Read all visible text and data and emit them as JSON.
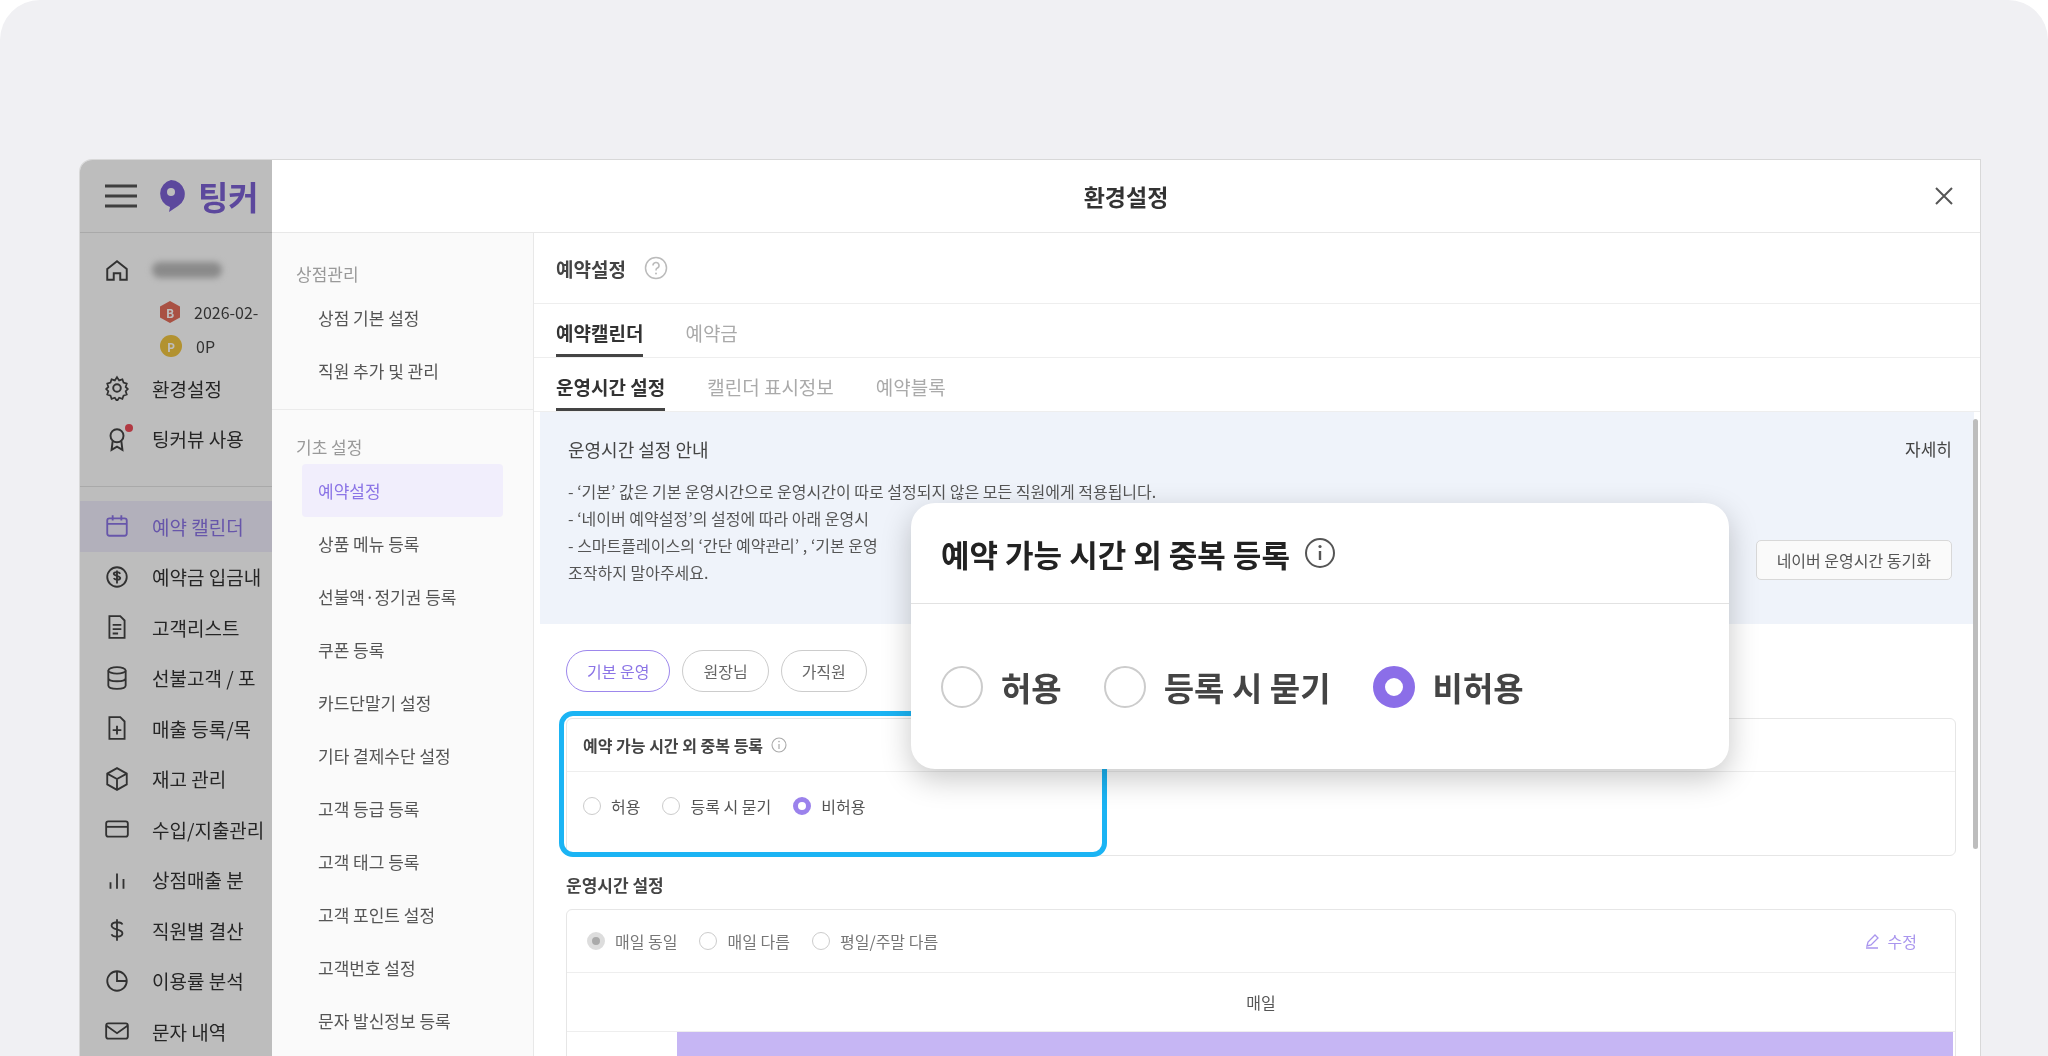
{
  "sidebar": {
    "logo": "팅커",
    "date": "2026-02-",
    "grade_badge": "B",
    "point_badge": "P",
    "points": "0P",
    "top_items": [
      {
        "label": "환경설정",
        "alert": false
      },
      {
        "label": "팅커뷰 사용",
        "alert": true
      }
    ],
    "items": [
      {
        "label": "예약 캘린더",
        "selected": true
      },
      {
        "label": "예약금 입금내",
        "selected": false
      },
      {
        "label": "고객리스트",
        "selected": false
      },
      {
        "label": "선불고객 / 포",
        "selected": false
      },
      {
        "label": "매출 등록/목",
        "selected": false
      },
      {
        "label": "재고 관리",
        "selected": false
      },
      {
        "label": "수입/지출관리",
        "selected": false
      },
      {
        "label": "상점매출 분",
        "selected": false
      },
      {
        "label": "직원별 결산",
        "selected": false
      },
      {
        "label": "이용률 분석",
        "selected": false
      },
      {
        "label": "문자 내역",
        "selected": false
      }
    ]
  },
  "modal": {
    "title": "환경설정",
    "menu": [
      {
        "heading": "상점관리",
        "items": [
          {
            "label": "상점 기본 설정",
            "selected": false
          },
          {
            "label": "직원 추가 및 관리",
            "selected": false
          }
        ]
      },
      {
        "heading": "기초 설정",
        "items": [
          {
            "label": "예약설정",
            "selected": true
          },
          {
            "label": "상품 메뉴 등록",
            "selected": false
          },
          {
            "label": "선불액·정기권 등록",
            "selected": false
          },
          {
            "label": "쿠폰 등록",
            "selected": false
          },
          {
            "label": "카드단말기 설정",
            "selected": false
          },
          {
            "label": "기타 결제수단 설정",
            "selected": false
          },
          {
            "label": "고객 등급 등록",
            "selected": false
          },
          {
            "label": "고객 태그 등록",
            "selected": false
          },
          {
            "label": "고객 포인트 설정",
            "selected": false
          },
          {
            "label": "고객번호 설정",
            "selected": false
          },
          {
            "label": "문자 발신정보 등록",
            "selected": false
          }
        ]
      }
    ],
    "page_title": "예약설정",
    "tabs": [
      {
        "label": "예약캘린더",
        "selected": true
      },
      {
        "label": "예약금",
        "selected": false
      }
    ],
    "subtabs": [
      {
        "label": "운영시간 설정",
        "selected": true
      },
      {
        "label": "캘린더 표시정보",
        "selected": false
      },
      {
        "label": "예약블록",
        "selected": false
      }
    ],
    "notice": {
      "title": "운영시간 설정 안내",
      "link": "자세히",
      "lines": [
        "- ‘기본’ 값은 기본 운영시간으로 운영시간이 따로 설정되지 않은 모든 직원에게 적용됩니다.",
        "- ‘네이버 예약설정’의 설정에 따라 아래 운영시",
        "- 스마트플레이스의 ‘간단 예약관리’ , ‘기본 운영",
        "조작하지 말아주세요."
      ],
      "button": "네이버 운영시간 동기화"
    },
    "staff_chips": [
      {
        "label": "기본 운영",
        "selected": true
      },
      {
        "label": "원장님",
        "selected": false
      },
      {
        "label": "가직원",
        "selected": false
      }
    ],
    "duplicate_setting": {
      "title": "예약 가능 시간 외 중복 등록",
      "highlighted": true,
      "options": [
        {
          "label": "허용",
          "selected": false
        },
        {
          "label": "등록 시 묻기",
          "selected": false
        },
        {
          "label": "비허용",
          "selected": true
        }
      ]
    },
    "hours": {
      "title": "운영시간 설정",
      "modes": [
        {
          "label": "매일 동일",
          "selected": true
        },
        {
          "label": "매일 다름",
          "selected": false
        },
        {
          "label": "평일/주말 다름",
          "selected": false
        }
      ],
      "edit": "수정",
      "column": "매일"
    }
  },
  "callout": {
    "title": "예약 가능 시간 외 중복 등록",
    "options": [
      {
        "label": "허용",
        "selected": false
      },
      {
        "label": "등록 시 묻기",
        "selected": false
      },
      {
        "label": "비허용",
        "selected": true
      }
    ]
  }
}
